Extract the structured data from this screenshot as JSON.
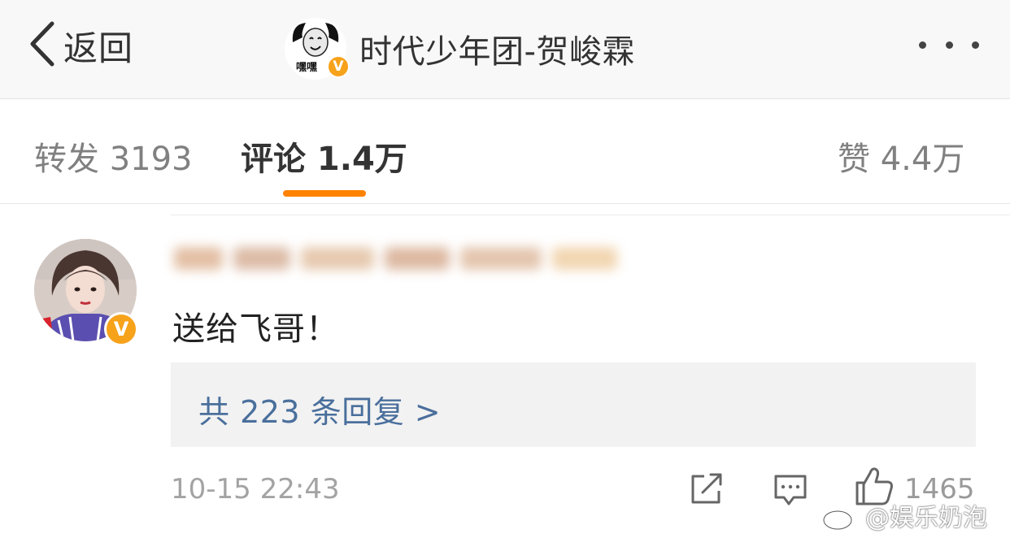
{
  "nav": {
    "back_label": "返回",
    "title": "时代少年团-贺峻霖",
    "avatar_caption": "嘿嘿",
    "verified_mark": "V"
  },
  "tabs": {
    "reposts": "转发 3193",
    "comments": "评论 1.4万",
    "likes": "赞 4.4万",
    "active": "comments",
    "indicator_color": "#ff8200"
  },
  "comment": {
    "verified_mark": "V",
    "text": "送给飞哥！",
    "replies_link": "共 223 条回复 >",
    "timestamp": "10-15 22:43",
    "like_count": "1465"
  },
  "icons": {
    "back": "chevron-left-icon",
    "more": "more-dots-icon",
    "share": "share-icon",
    "reply": "comment-icon",
    "like": "thumbs-up-icon",
    "weibo": "weibo-logo-icon"
  },
  "watermark": {
    "text": "@娱乐奶泡"
  },
  "colors": {
    "accent": "#ff8200",
    "link": "#4a6f9c",
    "verified": "#f7a21b"
  }
}
